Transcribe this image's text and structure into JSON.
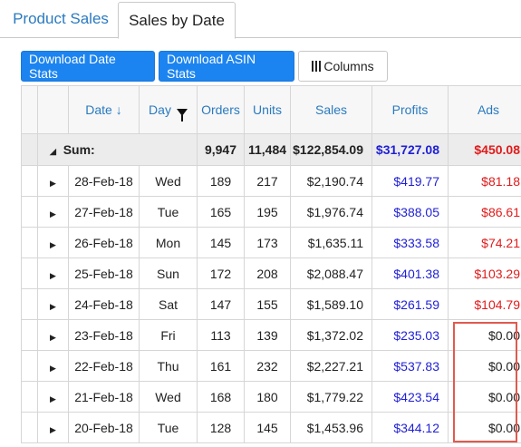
{
  "tabs": [
    {
      "label": "Product Sales",
      "active": false
    },
    {
      "label": "Sales by Date",
      "active": true
    }
  ],
  "toolbar": {
    "download_date": "Download Date Stats",
    "download_asin": "Download ASIN Stats",
    "columns": "Columns"
  },
  "columns": {
    "date": "Date",
    "date_sort": "↓",
    "day": "Day",
    "orders": "Orders",
    "units": "Units",
    "sales": "Sales",
    "profits": "Profits",
    "ads": "Ads"
  },
  "sum": {
    "label": "Sum:",
    "orders": "9,947",
    "units": "11,484",
    "sales": "$122,854.09",
    "profits": "$31,727.08",
    "ads": "$450.08"
  },
  "rows": [
    {
      "date": "28-Feb-18",
      "day": "Wed",
      "orders": "189",
      "units": "217",
      "sales": "$2,190.74",
      "profits": "$419.77",
      "ads": "$81.18"
    },
    {
      "date": "27-Feb-18",
      "day": "Tue",
      "orders": "165",
      "units": "195",
      "sales": "$1,976.74",
      "profits": "$388.05",
      "ads": "$86.61"
    },
    {
      "date": "26-Feb-18",
      "day": "Mon",
      "orders": "145",
      "units": "173",
      "sales": "$1,635.11",
      "profits": "$333.58",
      "ads": "$74.21"
    },
    {
      "date": "25-Feb-18",
      "day": "Sun",
      "orders": "172",
      "units": "208",
      "sales": "$2,088.47",
      "profits": "$401.38",
      "ads": "$103.29"
    },
    {
      "date": "24-Feb-18",
      "day": "Sat",
      "orders": "147",
      "units": "155",
      "sales": "$1,589.10",
      "profits": "$261.59",
      "ads": "$104.79"
    },
    {
      "date": "23-Feb-18",
      "day": "Fri",
      "orders": "113",
      "units": "139",
      "sales": "$1,372.02",
      "profits": "$235.03",
      "ads": "$0.00"
    },
    {
      "date": "22-Feb-18",
      "day": "Thu",
      "orders": "161",
      "units": "232",
      "sales": "$2,227.21",
      "profits": "$537.83",
      "ads": "$0.00"
    },
    {
      "date": "21-Feb-18",
      "day": "Wed",
      "orders": "168",
      "units": "180",
      "sales": "$1,779.22",
      "profits": "$423.54",
      "ads": "$0.00"
    },
    {
      "date": "20-Feb-18",
      "day": "Tue",
      "orders": "128",
      "units": "145",
      "sales": "$1,453.96",
      "profits": "$344.12",
      "ads": "$0.00"
    }
  ],
  "colors": {
    "primary": "#1c84f0",
    "profit": "#1f1fd6",
    "ads_positive": "#e01b1b",
    "highlight": "#e05a4f"
  }
}
